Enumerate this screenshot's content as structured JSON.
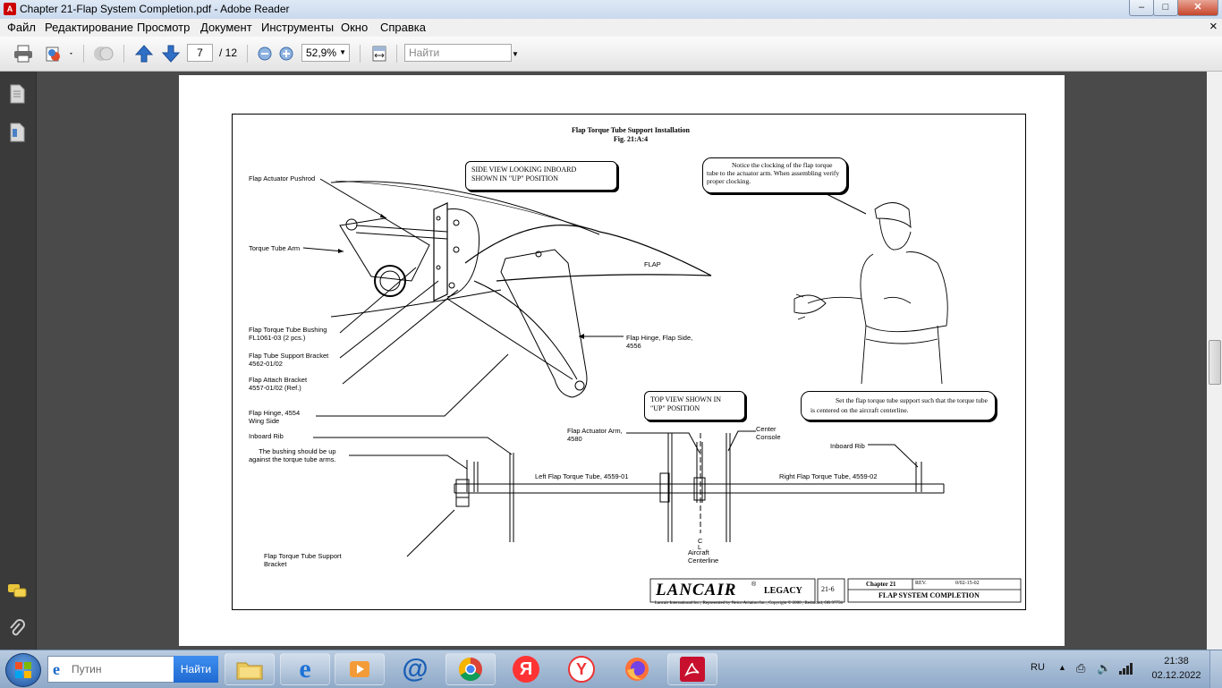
{
  "window": {
    "title": "Chapter 21-Flap System Completion.pdf - Adobe Reader",
    "controls": {
      "minimize": "–",
      "maximize": "□",
      "close": "✕"
    },
    "app_icon_text": "A"
  },
  "menu": {
    "items": [
      "Файл",
      "Редактирование",
      "Просмотр",
      "Документ",
      "Инструменты",
      "Окно",
      "Справка"
    ],
    "close_glyph": "×"
  },
  "toolbar": {
    "current_page": "7",
    "total_pages": "/ 12",
    "zoom": "52,9%",
    "find_placeholder": "Найти"
  },
  "document": {
    "title": "Flap Torque Tube Support  Installation",
    "figure": "Fig. 21:A:4",
    "callouts": {
      "side_view": "SIDE VIEW LOOKING INBOARD\nSHOWN IN \"UP\" POSITION",
      "notice": "Notice the clocking of the flap torque tube to the actuator arm.  When assembling verify proper clocking.",
      "top_view": "TOP VIEW SHOWN IN\n\"UP\" POSITION",
      "set_support": "Set the flap torque tube support such that the torque tube is centered on the aircraft centerline."
    },
    "labels": {
      "actuator_pushrod": "Flap Actuator Pushrod",
      "torque_tube_arm": "Torque Tube Arm",
      "flap": "FLAP",
      "bushing": "Flap Torque Tube Bushing\nFL1061-03 (2 pcs.)",
      "support_bracket": "Flap Tube Support Bracket\n4562-01/02",
      "attach_bracket": "Flap Attach Bracket\n4557-01/02 (Ref.)",
      "hinge_flap_side": "Flap Hinge, Flap Side,\n4556",
      "hinge_wing_side": "Flap Hinge, 4554\nWing Side",
      "inboard_rib_left": "Inboard Rib",
      "bushing_note": "The bushing should be up\nagainst the torque tube arms.",
      "actuator_arm": "Flap Actuator Arm,\n4580",
      "center_console": "Center\nConsole",
      "inboard_rib_right": "Inboard Rib",
      "left_tube": "Left Flap Torque Tube, 4559-01",
      "right_tube": "Right Flap Torque Tube, 4559-02",
      "support_bracket_bottom": "Flap Torque Tube Support\nBracket",
      "centerline_symbol": "C\nL",
      "aircraft_centerline": "Aircraft\nCenterline"
    },
    "title_block": {
      "brand": "LANCAIR",
      "registered": "®",
      "model": "LEGACY",
      "page": "21-6",
      "chapter": "Chapter 21",
      "rev_label": "REV.",
      "rev_value": "0/02-15-02",
      "section": "FLAP SYSTEM COMPLETION",
      "copyright": "Lancair International Inc., Represented by Neico Aviation Inc., Copyright © 2000 , Redmond, OR 97756"
    }
  },
  "taskbar": {
    "search_placeholder": "Путин",
    "search_button": "Найти",
    "apps": [
      "explorer",
      "internet-explorer",
      "media-player",
      "mail",
      "chrome",
      "yandex",
      "yandex-browser",
      "firefox",
      "adobe-reader"
    ],
    "language": "RU",
    "time": "21:38",
    "date": "02.12.2022"
  }
}
